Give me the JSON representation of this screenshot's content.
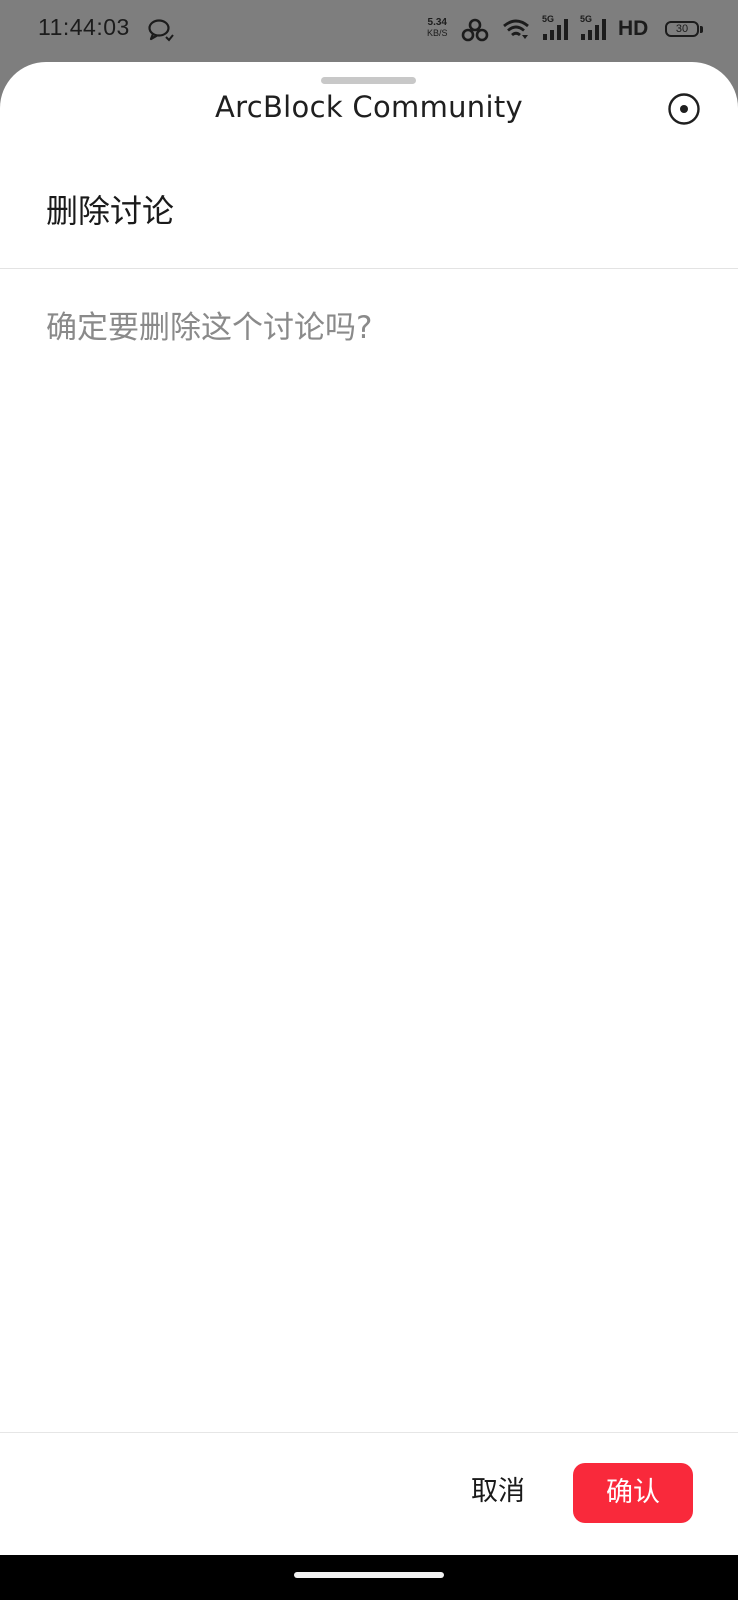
{
  "status_bar": {
    "time": "11:44:03",
    "net_speed_value": "5.34",
    "net_speed_unit": "KB/S",
    "signal1_label": "5G",
    "signal2_label": "5G",
    "hd_label": "HD",
    "battery_level": "30",
    "icons": [
      "message-bubble-icon",
      "hotspot-icon",
      "wifi-icon",
      "signal-icon",
      "signal-icon",
      "hd-icon",
      "battery-icon"
    ]
  },
  "sheet": {
    "app_title": "ArcBlock Community",
    "capsule_icon": "record-icon"
  },
  "dialog": {
    "title": "删除讨论",
    "message": "确定要删除这个讨论吗?",
    "cancel_label": "取消",
    "confirm_label": "确认"
  },
  "colors": {
    "confirm_button": "#f9293b",
    "backdrop": "#7e7e7e",
    "message_text": "#8a8a8a"
  }
}
